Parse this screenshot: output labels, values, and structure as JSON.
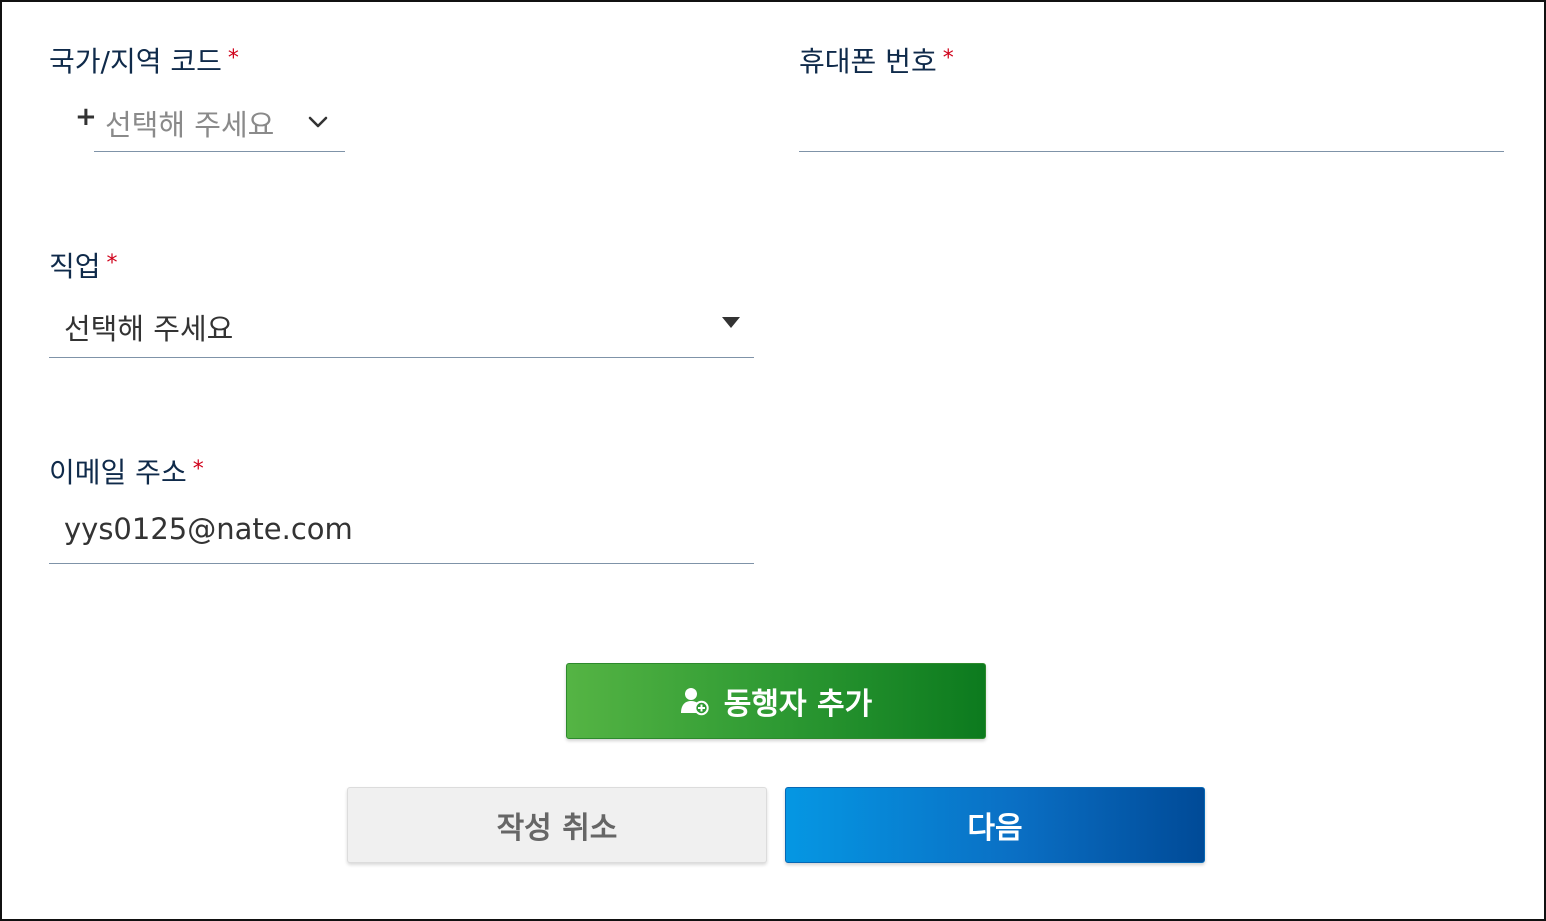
{
  "form": {
    "country_code": {
      "label": "국가/지역 코드",
      "required_mark": "*",
      "plus_sign": "+",
      "placeholder": "선택해 주세요",
      "dropdown_icon": "chevron-down-icon"
    },
    "mobile": {
      "label": "휴대폰 번호",
      "required_mark": "*",
      "value": ""
    },
    "occupation": {
      "label": "직업",
      "required_mark": "*",
      "selected": "선택해 주세요",
      "dropdown_icon": "caret-down-icon"
    },
    "email": {
      "label": "이메일 주소",
      "required_mark": "*",
      "value": "yys0125@nate.com"
    }
  },
  "actions": {
    "add_companion": {
      "label": "동행자 추가",
      "icon": "user-add-icon",
      "color": "#2e9a33"
    },
    "cancel": {
      "label": "작성 취소",
      "color": "#f0f0f0"
    },
    "next": {
      "label": "다음",
      "color": "#0a6fc4"
    }
  },
  "colors": {
    "label_text": "#0f2a4a",
    "required": "#d0021b",
    "underline": "#7f93a8"
  }
}
